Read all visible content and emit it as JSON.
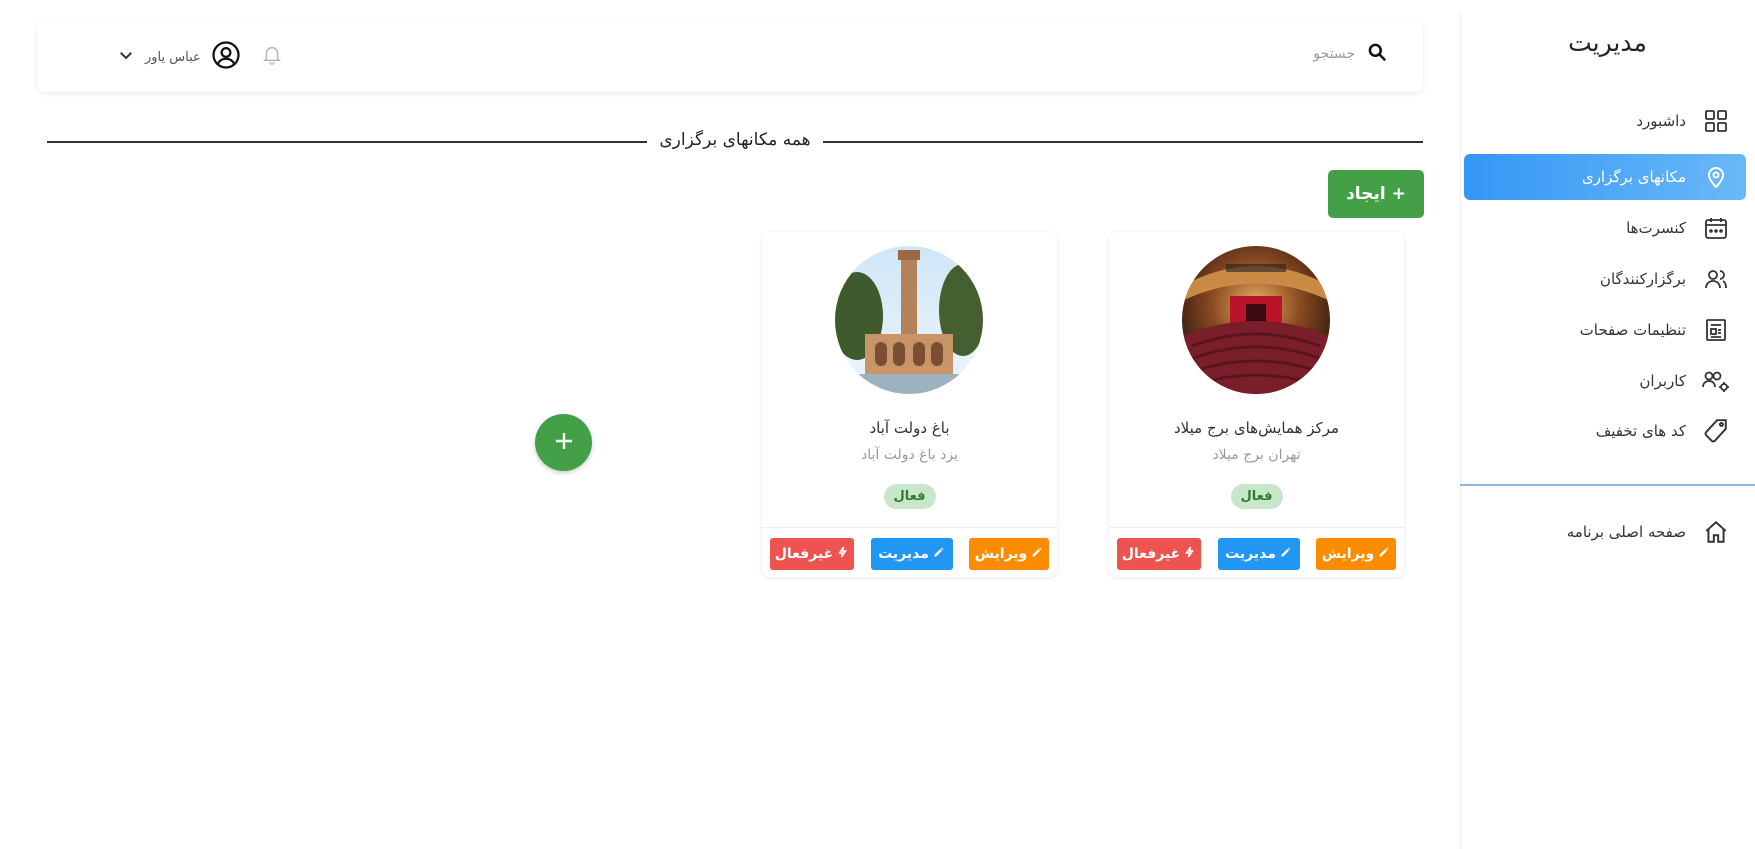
{
  "sidebar": {
    "title": "مدیریت",
    "items": [
      {
        "label": "داشبورد",
        "icon": "grid-icon"
      },
      {
        "label": "مکانهای برگزاری",
        "icon": "location-pin-icon",
        "active": true
      },
      {
        "label": "کنسرت‌ها",
        "icon": "calendar-icon"
      },
      {
        "label": "برگزارکنندگان",
        "icon": "organizers-icon"
      },
      {
        "label": "تنظیمات صفحات",
        "icon": "page-settings-icon"
      },
      {
        "label": "کاربران",
        "icon": "users-gear-icon"
      },
      {
        "label": "کد های تخفیف",
        "icon": "tag-icon"
      }
    ],
    "home": {
      "label": "صفحه اصلی برنامه",
      "icon": "home-icon"
    }
  },
  "topbar": {
    "search_placeholder": "جستجو",
    "user_name": "عباس یاور"
  },
  "section": {
    "title": "همه مکانهای برگزاری"
  },
  "create_button": {
    "label": "ایجاد"
  },
  "cards": [
    {
      "name": "مرکز همایش‌های برج میلاد",
      "location": "تهران برج میلاد",
      "status": "فعال",
      "actions": {
        "edit": "ویرایش",
        "manage": "مدیریت",
        "deactivate": "غیرفعال"
      }
    },
    {
      "name": "باغ دولت آباد",
      "location": "یزد باغ دولت آباد",
      "status": "فعال",
      "actions": {
        "edit": "ویرایش",
        "manage": "مدیریت",
        "deactivate": "غیرفعال"
      }
    }
  ],
  "colors": {
    "primary": "#3497f5",
    "success": "#43a047",
    "danger": "#ef5350",
    "info": "#2196f3",
    "warning": "#fb8c00"
  }
}
